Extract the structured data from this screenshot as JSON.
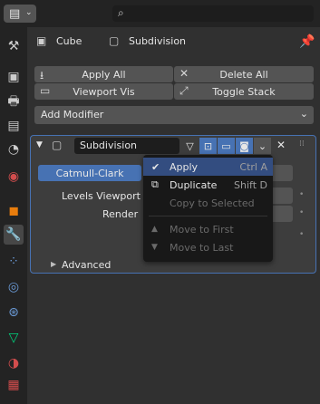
{
  "header": {
    "editor_icon": "properties-editor-icon",
    "search": {
      "placeholder": "",
      "icon": "search-icon"
    }
  },
  "sidebar": {
    "items": [
      {
        "name": "tool-icon",
        "glyph": "⚒",
        "color": "#cccccc",
        "active": false
      },
      {
        "name": "render-icon",
        "glyph": "▣",
        "color": "#cccccc",
        "active": false
      },
      {
        "name": "output-icon",
        "glyph": "🖶",
        "color": "#cccccc",
        "active": false
      },
      {
        "name": "view-layer-icon",
        "glyph": "▤",
        "color": "#cccccc",
        "active": false
      },
      {
        "name": "scene-icon",
        "glyph": "◔",
        "color": "#cccccc",
        "active": false
      },
      {
        "name": "world-icon",
        "glyph": "◉",
        "color": "#d34d4d",
        "active": false
      },
      {
        "name": "object-icon",
        "glyph": "◼",
        "color": "#e87d0d",
        "active": false
      },
      {
        "name": "modifier-wrench-icon",
        "glyph": "🔧",
        "color": "#6b9bd8",
        "active": true
      },
      {
        "name": "particles-icon",
        "glyph": "⁘",
        "color": "#6b9bd8",
        "active": false
      },
      {
        "name": "physics-icon",
        "glyph": "◎",
        "color": "#6b9bd8",
        "active": false
      },
      {
        "name": "constraints-icon",
        "glyph": "⊛",
        "color": "#6b9bd8",
        "active": false
      },
      {
        "name": "data-mesh-icon",
        "glyph": "▽",
        "color": "#00d37d",
        "active": false
      },
      {
        "name": "material-icon",
        "glyph": "◑",
        "color": "#d34d4d",
        "active": false
      },
      {
        "name": "texture-icon",
        "glyph": "▦",
        "color": "#d34d4d",
        "active": false
      }
    ]
  },
  "context": {
    "object_name": "Cube",
    "modifier_name": "Subdivision",
    "object_icon": "cube-object-icon",
    "modifier_icon": "subdivision-modifier-icon",
    "pin_icon": "pin-icon"
  },
  "toolbar": {
    "apply_all": "Apply All",
    "delete_all": "Delete All",
    "viewport_vis": "Viewport Vis",
    "toggle_stack": "Toggle Stack"
  },
  "add_modifier": {
    "label": "Add Modifier"
  },
  "modifier_panel": {
    "name": "Subdivision",
    "catmull_clark": "Catmull-Clark",
    "levels_viewport": "Levels Viewport",
    "render": "Render",
    "advanced": "Advanced"
  },
  "context_menu": {
    "items": [
      {
        "label": "Apply",
        "shortcut": "Ctrl A",
        "icon": "checkmark-icon",
        "glyph": "✔",
        "highlighted": true,
        "disabled": false
      },
      {
        "label": "Duplicate",
        "shortcut": "Shift D",
        "icon": "duplicate-icon",
        "glyph": "⧉",
        "highlighted": false,
        "disabled": false
      },
      {
        "label": "Copy to Selected",
        "shortcut": "",
        "icon": "",
        "glyph": "",
        "highlighted": false,
        "disabled": true
      },
      {
        "label": "Move to First",
        "shortcut": "",
        "icon": "arrow-up-icon",
        "glyph": "▲",
        "highlighted": false,
        "disabled": true
      },
      {
        "label": "Move to Last",
        "shortcut": "",
        "icon": "arrow-down-icon",
        "glyph": "▼",
        "highlighted": false,
        "disabled": true
      }
    ]
  },
  "colors": {
    "accent": "#4772b3",
    "highlight": "#334d80",
    "panel": "#3d3d3d",
    "background": "#303030"
  }
}
